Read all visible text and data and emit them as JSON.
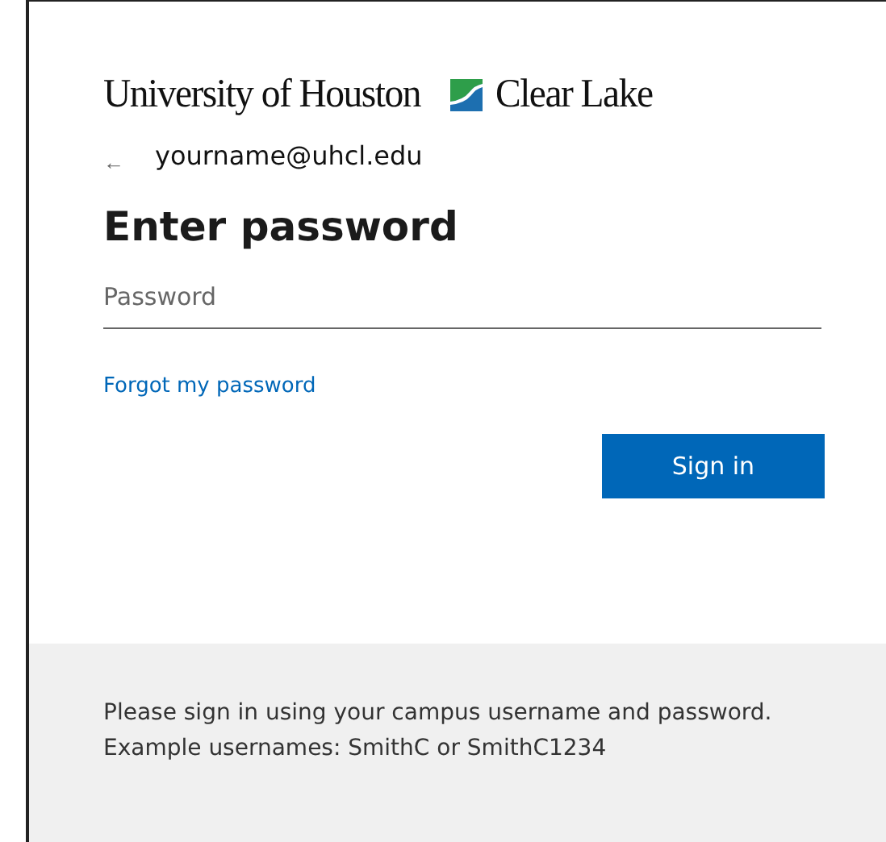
{
  "logo": {
    "left": "University of Houston",
    "right": "Clear Lake"
  },
  "identity": {
    "back": "←",
    "email": "yourname@uhcl.edu"
  },
  "title": "Enter password",
  "password": {
    "placeholder": "Password"
  },
  "forgot_link": "Forgot my password",
  "sign_in_button": "Sign in",
  "footer": "Please sign in using your campus username and password. Example usernames: SmithC or SmithC1234"
}
